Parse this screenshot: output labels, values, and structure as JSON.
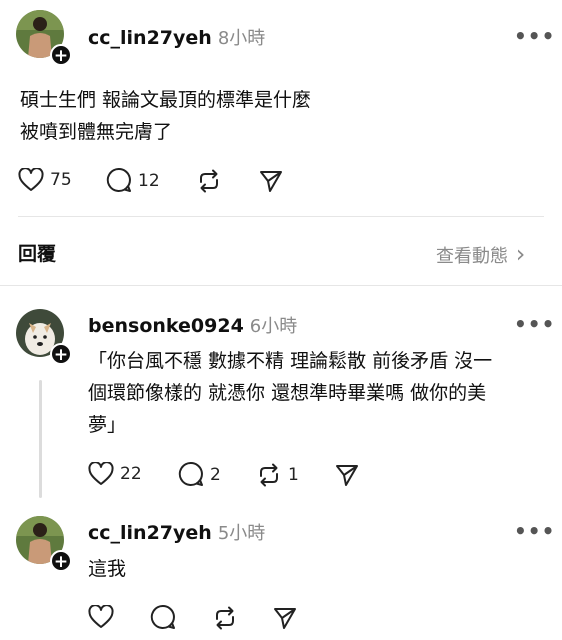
{
  "post": {
    "username": "cc_lin27yeh",
    "time": "8小時",
    "line1": "碩士生們 報論文最頂的標準是什麼",
    "line2": "被噴到體無完膚了",
    "likes": "75",
    "comments": "12"
  },
  "replies_bar": {
    "label": "回覆",
    "view_activity": "查看動態",
    "chevron": "›"
  },
  "comment1": {
    "username": "bensonke0924",
    "time": "6小時",
    "line1": "「你台風不穩 數據不精 理論鬆散 前後矛盾 沒一",
    "line2": "個環節像樣的 就憑你 還想準時畢業嗎 做你的美",
    "line3": "夢」",
    "likes": "22",
    "comments": "2",
    "reposts": "1"
  },
  "comment2": {
    "username": "cc_lin27yeh",
    "time": "5小時",
    "text": "這我"
  },
  "ui": {
    "more": "•••",
    "follow_plus": "+"
  }
}
